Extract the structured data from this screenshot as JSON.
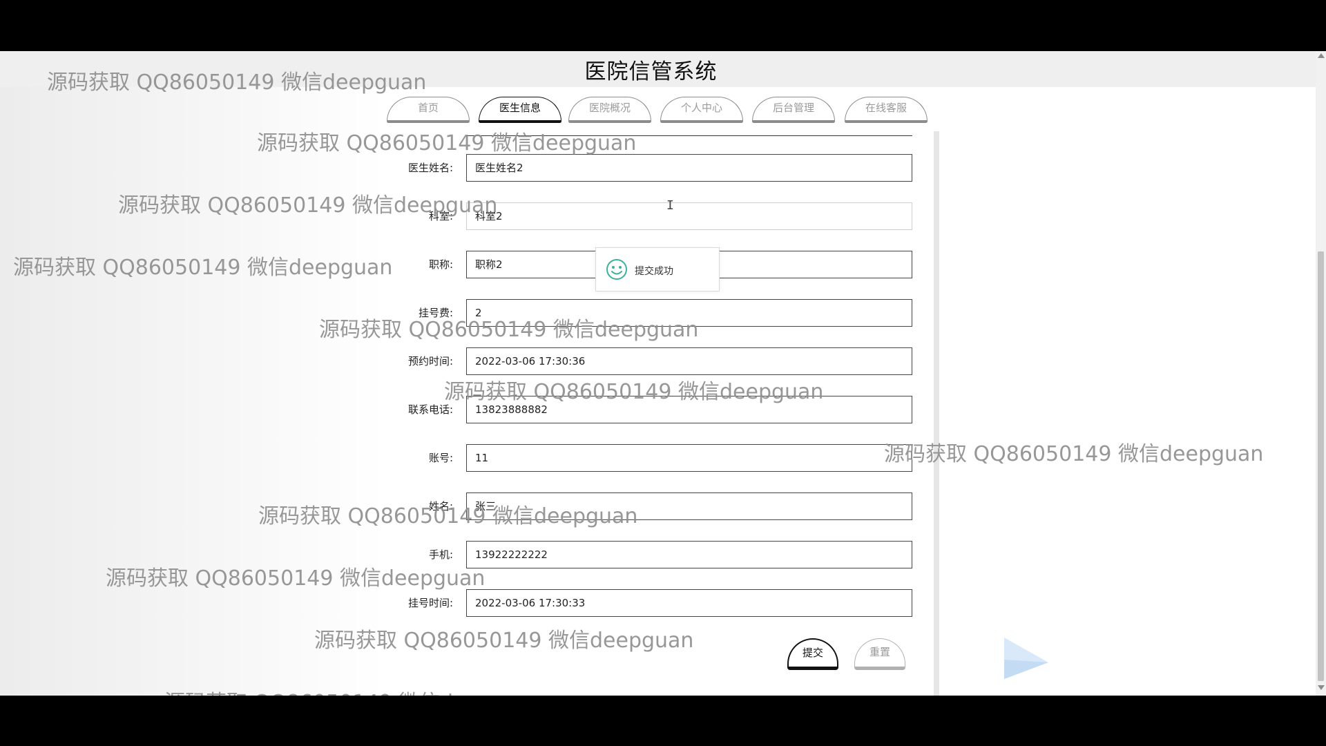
{
  "site_title": "医院信管系统",
  "nav": [
    {
      "label": "首页",
      "active": false
    },
    {
      "label": "医生信息",
      "active": true
    },
    {
      "label": "医院概况",
      "active": false
    },
    {
      "label": "个人中心",
      "active": false
    },
    {
      "label": "后台管理",
      "active": false
    },
    {
      "label": "在线客服",
      "active": false
    }
  ],
  "form": {
    "fields": [
      {
        "label": "医生姓名:",
        "value": "医生姓名2"
      },
      {
        "label": "科室:",
        "value": "科室2"
      },
      {
        "label": "职称:",
        "value": "职称2"
      },
      {
        "label": "挂号费:",
        "value": "2"
      },
      {
        "label": "预约时间:",
        "value": "2022-03-06 17:30:36"
      },
      {
        "label": "联系电话:",
        "value": "13823888882"
      },
      {
        "label": "账号:",
        "value": "11"
      },
      {
        "label": "姓名:",
        "value": "张三"
      },
      {
        "label": "手机:",
        "value": "13922222222"
      },
      {
        "label": "挂号时间:",
        "value": "2022-03-06 17:30:33"
      }
    ],
    "submit_label": "提交",
    "reset_label": "重置"
  },
  "toast": {
    "message": "提交成功",
    "icon": "smile-icon",
    "color": "#3bb29a"
  },
  "watermark_text": "源码获取 QQ86050149 微信deepguan",
  "colors": {
    "active_tab_border": "#111111",
    "inactive_tab_border": "#8c8c8c",
    "success": "#3bb29a"
  }
}
